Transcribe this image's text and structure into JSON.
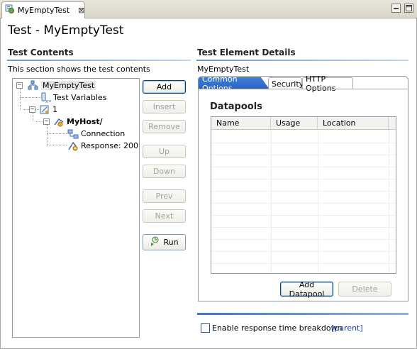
{
  "editor_tab": {
    "title": "MyEmptyTest",
    "close_glyph": "⊠"
  },
  "window_controls": {
    "minimize": "▭",
    "maximize": "□"
  },
  "page_title": "Test - MyEmptyTest",
  "left": {
    "section_title": "Test Contents",
    "description": "This section shows the test contents",
    "tree": {
      "root": "MyEmptyTest",
      "test_variables": "Test Variables",
      "loop": "1",
      "host": "MyHost/",
      "connection": "Connection",
      "response": "Response: 200"
    },
    "buttons": {
      "add": "Add",
      "insert": "Insert",
      "remove": "Remove",
      "up": "Up",
      "down": "Down",
      "prev": "Prev",
      "next": "Next",
      "run": "Run"
    }
  },
  "right": {
    "section_title": "Test Element Details",
    "element_name": "MyEmptyTest",
    "tabs": [
      {
        "label": "Common Options",
        "active": true
      },
      {
        "label": "Security",
        "active": false
      },
      {
        "label": "HTTP Options",
        "active": false
      }
    ],
    "datapools": {
      "title": "Datapools",
      "columns": [
        "Name",
        "Usage",
        "Location"
      ],
      "rows": [],
      "add_button": "Add Datapool",
      "delete_button": "Delete"
    },
    "footer": {
      "checkbox_label": "Enable response time breakdown",
      "checked": false,
      "link": "[parent]"
    }
  },
  "colors": {
    "accent": "#2a62c0",
    "section_line": "#6e98c9",
    "link": "#1a3ea6",
    "disabled_text": "#a3a39b"
  },
  "icons": {
    "tab": "test-icon",
    "root": "test-suite-icon",
    "variables": "variables-icon",
    "loop": "loop-icon",
    "host": "http-host-icon",
    "connection": "connection-icon",
    "response": "response-icon",
    "run": "run-icon"
  }
}
